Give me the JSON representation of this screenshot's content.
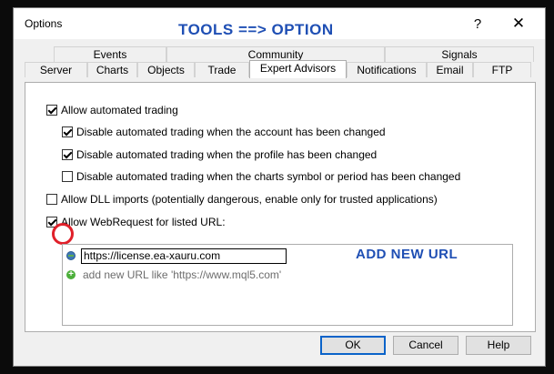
{
  "window": {
    "title": "Options",
    "help_glyph": "?",
    "close_glyph": "✕"
  },
  "annotations": {
    "title": "TOOLS ==> OPTION",
    "url": "ADD NEW URL"
  },
  "tabs": {
    "row1": [
      {
        "label": "Events"
      },
      {
        "label": "Community"
      },
      {
        "label": "Signals"
      }
    ],
    "row2": [
      {
        "label": "Server"
      },
      {
        "label": "Charts"
      },
      {
        "label": "Objects"
      },
      {
        "label": "Trade"
      },
      {
        "label": "Expert Advisors"
      },
      {
        "label": "Notifications"
      },
      {
        "label": "Email"
      },
      {
        "label": "FTP"
      }
    ],
    "active": "Expert Advisors"
  },
  "options": [
    {
      "label": "Allow automated trading",
      "checked": true
    },
    {
      "label": "Disable automated trading when the account has been changed",
      "checked": true
    },
    {
      "label": "Disable automated trading when the profile has been changed",
      "checked": true
    },
    {
      "label": "Disable automated trading when the charts symbol or period has been changed",
      "checked": false
    },
    {
      "label": "Allow DLL imports (potentially dangerous, enable only for trusted applications)",
      "checked": false
    },
    {
      "label": "Allow WebRequest for listed URL:",
      "checked": true
    }
  ],
  "url_list": {
    "entry_value": "https://license.ea-xauru.com",
    "add_hint": "add new URL like 'https://www.mql5.com'"
  },
  "buttons": {
    "ok": "OK",
    "cancel": "Cancel",
    "help": "Help"
  }
}
